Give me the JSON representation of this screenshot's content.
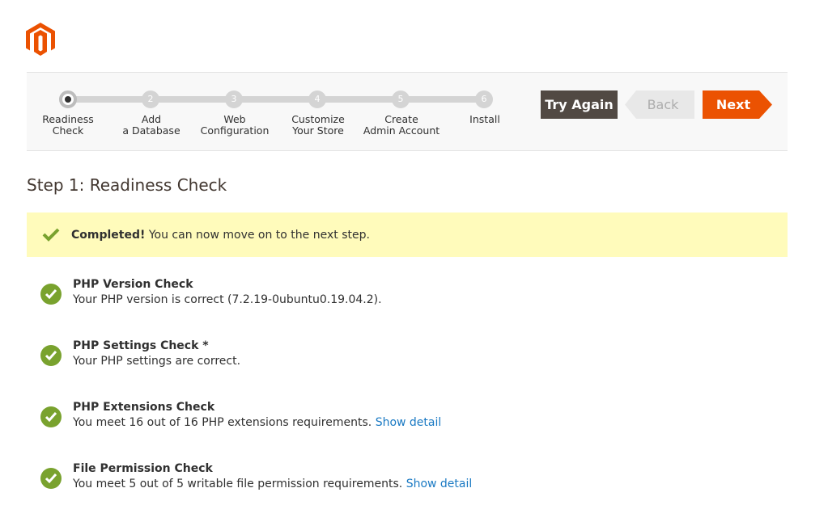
{
  "wizard": {
    "steps": [
      {
        "number": "1",
        "label": "Readiness\nCheck"
      },
      {
        "number": "2",
        "label": "Add\na Database"
      },
      {
        "number": "3",
        "label": "Web\nConfiguration"
      },
      {
        "number": "4",
        "label": "Customize\nYour Store"
      },
      {
        "number": "5",
        "label": "Create\nAdmin Account"
      },
      {
        "number": "6",
        "label": "Install"
      }
    ],
    "buttons": {
      "try_again": "Try Again",
      "back": "Back",
      "next": "Next"
    }
  },
  "page_title": "Step 1: Readiness Check",
  "banner": {
    "strong": "Completed!",
    "text": " You can now move on to the next step."
  },
  "checks": [
    {
      "title": "PHP Version Check",
      "desc": "Your PHP version is correct (7.2.19-0ubuntu0.19.04.2).",
      "link": ""
    },
    {
      "title": "PHP Settings Check *",
      "desc": "Your PHP settings are correct.",
      "link": ""
    },
    {
      "title": "PHP Extensions Check",
      "desc": "You meet 16 out of 16 PHP extensions requirements. ",
      "link": "Show detail"
    },
    {
      "title": "File Permission Check",
      "desc": "You meet 5 out of 5 writable file permission requirements. ",
      "link": "Show detail"
    }
  ],
  "colors": {
    "accent": "#eb5202",
    "success": "#79a22e",
    "banner_bg": "#fffbbb",
    "try_again_bg": "#514943",
    "link": "#1979c3"
  }
}
